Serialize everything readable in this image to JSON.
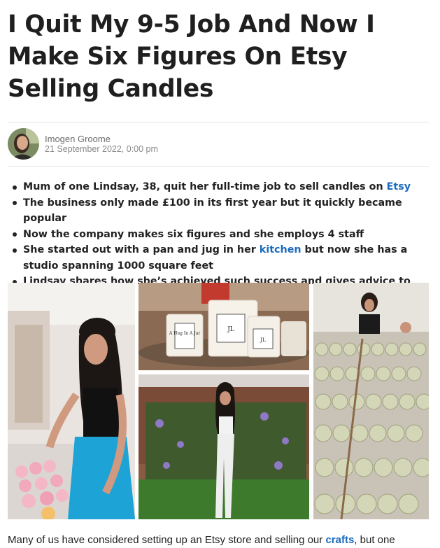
{
  "article": {
    "title": "I Quit My 9-5 Job And Now I Make Six Figures On Etsy Selling Candles",
    "author": "Imogen Groome",
    "date": "21 September 2022, 0:00 pm",
    "bullets": [
      {
        "before": "Mum of one Lindsay, 38, quit her full-time job to sell candles on ",
        "link": "Etsy",
        "after": ""
      },
      {
        "before": "The business only made £100 in its first year but it quickly became popular",
        "link": "",
        "after": ""
      },
      {
        "before": "Now the company makes six figures and she employs 4 staff",
        "link": "",
        "after": ""
      },
      {
        "before": "She started out with a pan and jug in her ",
        "link": "kitchen",
        "after": " but now she has a studio spanning 1000 square feet"
      },
      {
        "before": "Lindsay shares how she’s achieved such success and gives advice to others",
        "link": "",
        "after": ""
      }
    ],
    "paragraph": {
      "before": "Many of us have considered setting up an Etsy store and selling our ",
      "link": "crafts",
      "after": ", but one"
    },
    "candle_labels": {
      "left": "A Hug In A Jar",
      "middle": "JL",
      "right": "JL"
    }
  },
  "icons": {
    "avatar": "author-avatar-photo"
  },
  "colors": {
    "link": "#1a6bbf",
    "text": "#222222",
    "rule": "#e6e6e6",
    "meta": "#6b6b6b"
  }
}
